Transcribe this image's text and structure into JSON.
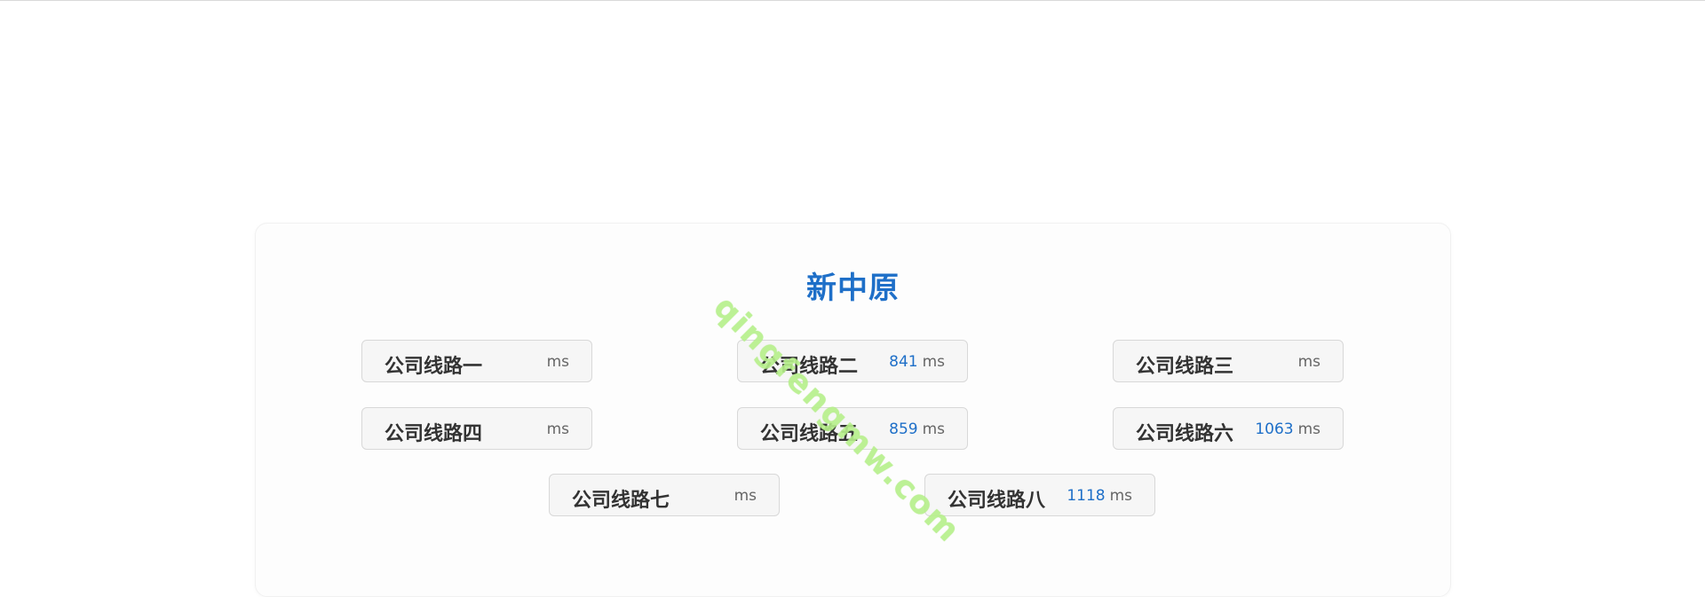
{
  "title": "新中原",
  "watermark": "qingfengmw.com",
  "unit": "ms",
  "lines": [
    {
      "name": "公司线路一",
      "value": ""
    },
    {
      "name": "公司线路二",
      "value": "841"
    },
    {
      "name": "公司线路三",
      "value": ""
    },
    {
      "name": "公司线路四",
      "value": ""
    },
    {
      "name": "公司线路五",
      "value": "859"
    },
    {
      "name": "公司线路六",
      "value": "1063"
    },
    {
      "name": "公司线路七",
      "value": ""
    },
    {
      "name": "公司线路八",
      "value": "1118"
    }
  ],
  "colors": {
    "accent": "#1e6fc8",
    "watermark": "#b6f08a"
  }
}
